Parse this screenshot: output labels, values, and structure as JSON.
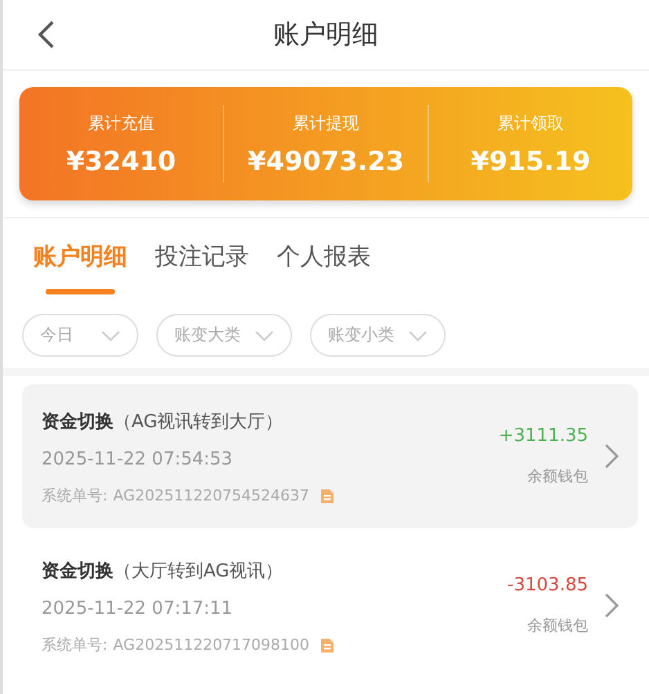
{
  "header": {
    "title": "账户明细"
  },
  "summary": [
    {
      "label": "累计充值",
      "value": "¥32410"
    },
    {
      "label": "累计提现",
      "value": "¥49073.23"
    },
    {
      "label": "累计领取",
      "value": "¥915.19"
    }
  ],
  "tabs": [
    {
      "label": "账户明细",
      "selected": true
    },
    {
      "label": "投注记录",
      "selected": false
    },
    {
      "label": "个人报表",
      "selected": false
    }
  ],
  "filters": [
    {
      "label": "今日"
    },
    {
      "label": "账变大类"
    },
    {
      "label": "账变小类"
    }
  ],
  "records": [
    {
      "type": "资金切换",
      "detail": "（AG视讯转到大厅）",
      "time": "2025-11-22 07:54:53",
      "order_label": "系统单号:",
      "order_no": "AG202511220754524637",
      "amount": "+3111.35",
      "kind": "income",
      "wallet": "余额钱包",
      "selected": true
    },
    {
      "type": "资金切换",
      "detail": "（大厅转到AG视讯）",
      "time": "2025-11-22 07:17:11",
      "order_label": "系统单号:",
      "order_no": "AG202511220717098100",
      "amount": "-3103.85",
      "kind": "expense",
      "wallet": "余额钱包",
      "selected": false
    }
  ]
}
